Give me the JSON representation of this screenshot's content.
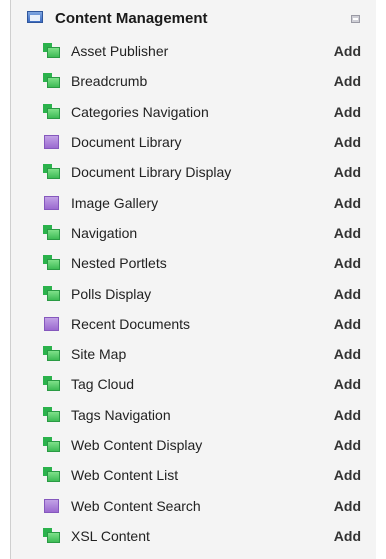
{
  "category": {
    "title": "Content Management",
    "icon": "portlet-window-icon",
    "collapse_icon": "collapse-icon"
  },
  "add_label": "Add",
  "colors": {
    "green_icon": "#3dbb55",
    "purple_icon": "#9b6ad0",
    "panel_bg": "#f4f4f4"
  },
  "items": [
    {
      "label": "Asset Publisher",
      "icon": "green"
    },
    {
      "label": "Breadcrumb",
      "icon": "green"
    },
    {
      "label": "Categories Navigation",
      "icon": "green"
    },
    {
      "label": "Document Library",
      "icon": "purple"
    },
    {
      "label": "Document Library Display",
      "icon": "green"
    },
    {
      "label": "Image Gallery",
      "icon": "purple"
    },
    {
      "label": "Navigation",
      "icon": "green"
    },
    {
      "label": "Nested Portlets",
      "icon": "green"
    },
    {
      "label": "Polls Display",
      "icon": "green"
    },
    {
      "label": "Recent Documents",
      "icon": "purple"
    },
    {
      "label": "Site Map",
      "icon": "green"
    },
    {
      "label": "Tag Cloud",
      "icon": "green"
    },
    {
      "label": "Tags Navigation",
      "icon": "green"
    },
    {
      "label": "Web Content Display",
      "icon": "green"
    },
    {
      "label": "Web Content List",
      "icon": "green"
    },
    {
      "label": "Web Content Search",
      "icon": "purple"
    },
    {
      "label": "XSL Content",
      "icon": "green"
    }
  ]
}
